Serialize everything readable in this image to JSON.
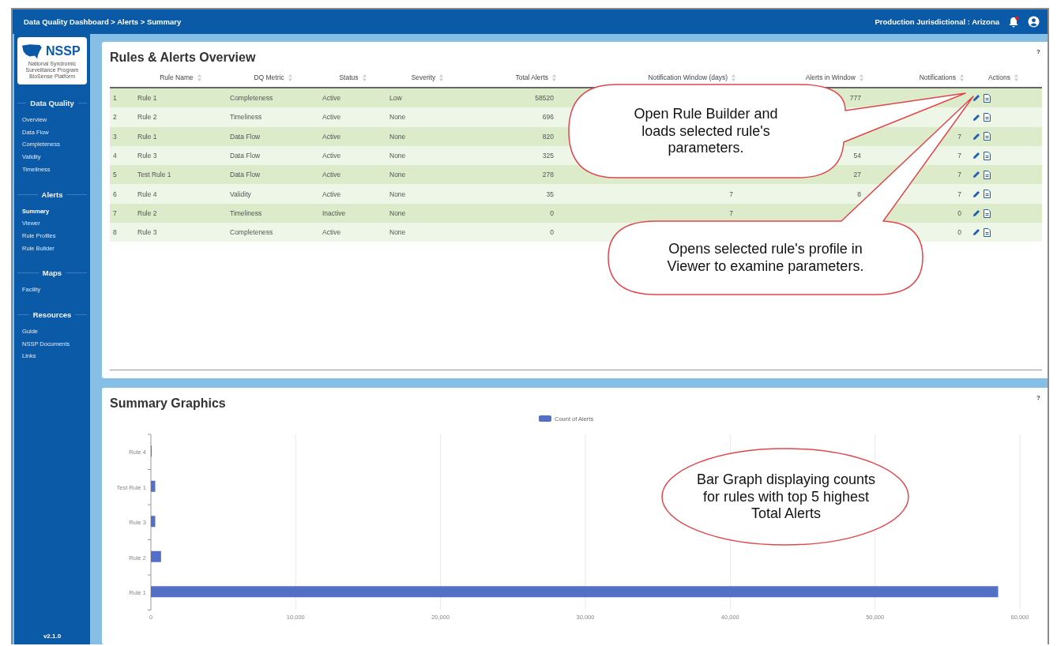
{
  "top_bar": {
    "breadcrumb": "Data Quality Dashboard > Alerts > Summary",
    "jurisdiction": "Production Jurisdictional : Arizona"
  },
  "sidebar": {
    "logo": {
      "name": "NSSP",
      "subtitle": "National Syndromic Surveillance Program",
      "platform": "BioSense Platform"
    },
    "sections": [
      {
        "title": "Data Quality",
        "items": [
          {
            "label": "Overview",
            "selected": false
          },
          {
            "label": "Data Flow",
            "selected": false
          },
          {
            "label": "Completeness",
            "selected": false
          },
          {
            "label": "Validity",
            "selected": false
          },
          {
            "label": "Timeliness",
            "selected": false
          }
        ]
      },
      {
        "title": "Alerts",
        "items": [
          {
            "label": "Summary",
            "selected": true
          },
          {
            "label": "Viewer",
            "selected": false
          },
          {
            "label": "Rule Profiles",
            "selected": false
          },
          {
            "label": "Rule Builder",
            "selected": false
          }
        ]
      },
      {
        "title": "Maps",
        "items": [
          {
            "label": "Facility",
            "selected": false
          }
        ]
      },
      {
        "title": "Resources",
        "items": [
          {
            "label": "Guide",
            "selected": false
          },
          {
            "label": "NSSP Documents",
            "selected": false
          },
          {
            "label": "Links",
            "selected": false
          }
        ]
      }
    ],
    "version": "v2.1.0"
  },
  "overview": {
    "title": "Rules & Alerts Overview",
    "help": "?",
    "columns": [
      "Rule Name",
      "DQ Metric",
      "Status",
      "Severity",
      "Total Alerts",
      "Notification Window (days)",
      "Alerts in Window",
      "Notifications",
      "Actions"
    ],
    "rows": [
      {
        "no": "1",
        "rule_name": "Rule 1",
        "dq_metric": "Completeness",
        "status": "Active",
        "severity": "Low",
        "total_alerts": "58520",
        "alerts_in_window": "777"
      },
      {
        "no": "2",
        "rule_name": "Rule 2",
        "dq_metric": "Timeliness",
        "status": "Active",
        "severity": "None",
        "total_alerts": "696"
      },
      {
        "no": "3",
        "rule_name": "Rule 1",
        "dq_metric": "Data Flow",
        "status": "Active",
        "severity": "None",
        "total_alerts": "820",
        "notifications": "7"
      },
      {
        "no": "4",
        "rule_name": "Rule 3",
        "dq_metric": "Data Flow",
        "status": "Active",
        "severity": "None",
        "total_alerts": "325",
        "alerts_in_window": "54",
        "notifications": "7"
      },
      {
        "no": "5",
        "rule_name": "Test Rule 1",
        "dq_metric": "Data Flow",
        "status": "Active",
        "severity": "None",
        "total_alerts": "278",
        "alerts_in_window": "27",
        "notifications": "7"
      },
      {
        "no": "6",
        "rule_name": "Rule 4",
        "dq_metric": "Validity",
        "status": "Active",
        "severity": "None",
        "total_alerts": "35",
        "notification_window": "7",
        "alerts_in_window": "8",
        "notifications": "7"
      },
      {
        "no": "7",
        "rule_name": "Rule 2",
        "dq_metric": "Timeliness",
        "status": "Inactive",
        "severity": "None",
        "total_alerts": "0",
        "notification_window": "7",
        "notifications": "0"
      },
      {
        "no": "8",
        "rule_name": "Rule 3",
        "dq_metric": "Completeness",
        "status": "Active",
        "severity": "None",
        "total_alerts": "0",
        "notifications": "0"
      }
    ]
  },
  "summary_graphics": {
    "title": "Summary Graphics",
    "help": "?",
    "chart_data": {
      "type": "bar",
      "orientation": "horizontal",
      "categories": [
        "Rule 4",
        "Test Rule 1",
        "Rule 3",
        "Rule 2",
        "Rule 1"
      ],
      "series": [
        {
          "name": "Count of Alerts",
          "color": "#5470c6",
          "values": [
            0,
            300,
            300,
            700,
            58500
          ]
        }
      ],
      "grid": true,
      "xlim": [
        0,
        60000
      ],
      "xticks": [
        {
          "value": 0,
          "label": "0"
        },
        {
          "value": 10000,
          "label": "10,000"
        },
        {
          "value": 20000,
          "label": "20,000"
        },
        {
          "value": 30000,
          "label": "30,000"
        },
        {
          "value": 40000,
          "label": "40,000"
        },
        {
          "value": 50000,
          "label": "50,000"
        },
        {
          "value": 60000,
          "label": "60,000"
        }
      ]
    }
  },
  "callouts": [
    {
      "kind": "speech",
      "text": "Open Rule Builder and loads selected rule's parameters."
    },
    {
      "kind": "speech",
      "text": "Opens selected rule's profile in Viewer to examine parameters."
    },
    {
      "kind": "ellipse",
      "text": "Bar Graph displaying counts for rules with top 5 highest Total Alerts"
    }
  ]
}
